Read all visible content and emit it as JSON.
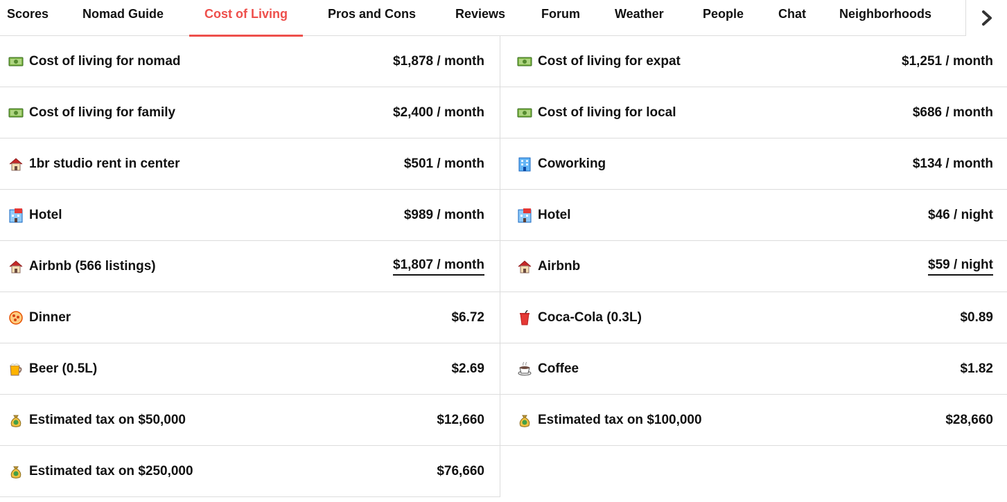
{
  "nav": {
    "tabs": [
      {
        "label": "Scores"
      },
      {
        "label": "Nomad Guide"
      },
      {
        "label": "Cost of Living"
      },
      {
        "label": "Pros and Cons"
      },
      {
        "label": "Reviews"
      },
      {
        "label": "Forum"
      },
      {
        "label": "Weather"
      },
      {
        "label": "People"
      },
      {
        "label": "Chat"
      },
      {
        "label": "Neighborhoods"
      }
    ],
    "active_tab": "Cost of Living",
    "next_icon": "chevron-right-icon"
  },
  "rows": [
    {
      "left": {
        "icon": "money-icon",
        "label": "Cost of living for nomad",
        "value": "$1,878 / month"
      },
      "right": {
        "icon": "money-icon",
        "label": "Cost of living for expat",
        "value": "$1,251 / month"
      }
    },
    {
      "left": {
        "icon": "money-icon",
        "label": "Cost of living for family",
        "value": "$2,400 / month"
      },
      "right": {
        "icon": "money-icon",
        "label": "Cost of living for local",
        "value": "$686 / month"
      }
    },
    {
      "left": {
        "icon": "house-icon",
        "label": "1br studio rent in center",
        "value": "$501 / month"
      },
      "right": {
        "icon": "office-building-icon",
        "label": "Coworking",
        "value": "$134 / month"
      }
    },
    {
      "left": {
        "icon": "hotel-icon",
        "label": "Hotel",
        "value": "$989 / month"
      },
      "right": {
        "icon": "hotel-icon",
        "label": "Hotel",
        "value": "$46 / night"
      }
    },
    {
      "left": {
        "icon": "house-icon",
        "label": "Airbnb (566 listings)",
        "value": "$1,807 / month"
      },
      "right": {
        "icon": "house-icon",
        "label": "Airbnb",
        "value": "$59 / night"
      }
    },
    {
      "left": {
        "icon": "pizza-icon",
        "label": "Dinner",
        "value": "$6.72"
      },
      "right": {
        "icon": "cup-with-straw-icon",
        "label": "Coca-Cola (0.3L)",
        "value": "$0.89"
      }
    },
    {
      "left": {
        "icon": "beer-icon",
        "label": "Beer (0.5L)",
        "value": "$2.69"
      },
      "right": {
        "icon": "coffee-icon",
        "label": "Coffee",
        "value": "$1.82"
      }
    },
    {
      "left": {
        "icon": "money-bag-icon",
        "label": "Estimated tax on $50,000",
        "value": "$12,660"
      },
      "right": {
        "icon": "money-bag-icon",
        "label": "Estimated tax on $100,000",
        "value": "$28,660"
      }
    },
    {
      "left": {
        "icon": "money-bag-icon",
        "label": "Estimated tax on $250,000",
        "value": "$76,660"
      }
    }
  ],
  "colors": {
    "accent": "#ee4f4b",
    "text": "#111111",
    "divider": "#dcdcdc"
  }
}
